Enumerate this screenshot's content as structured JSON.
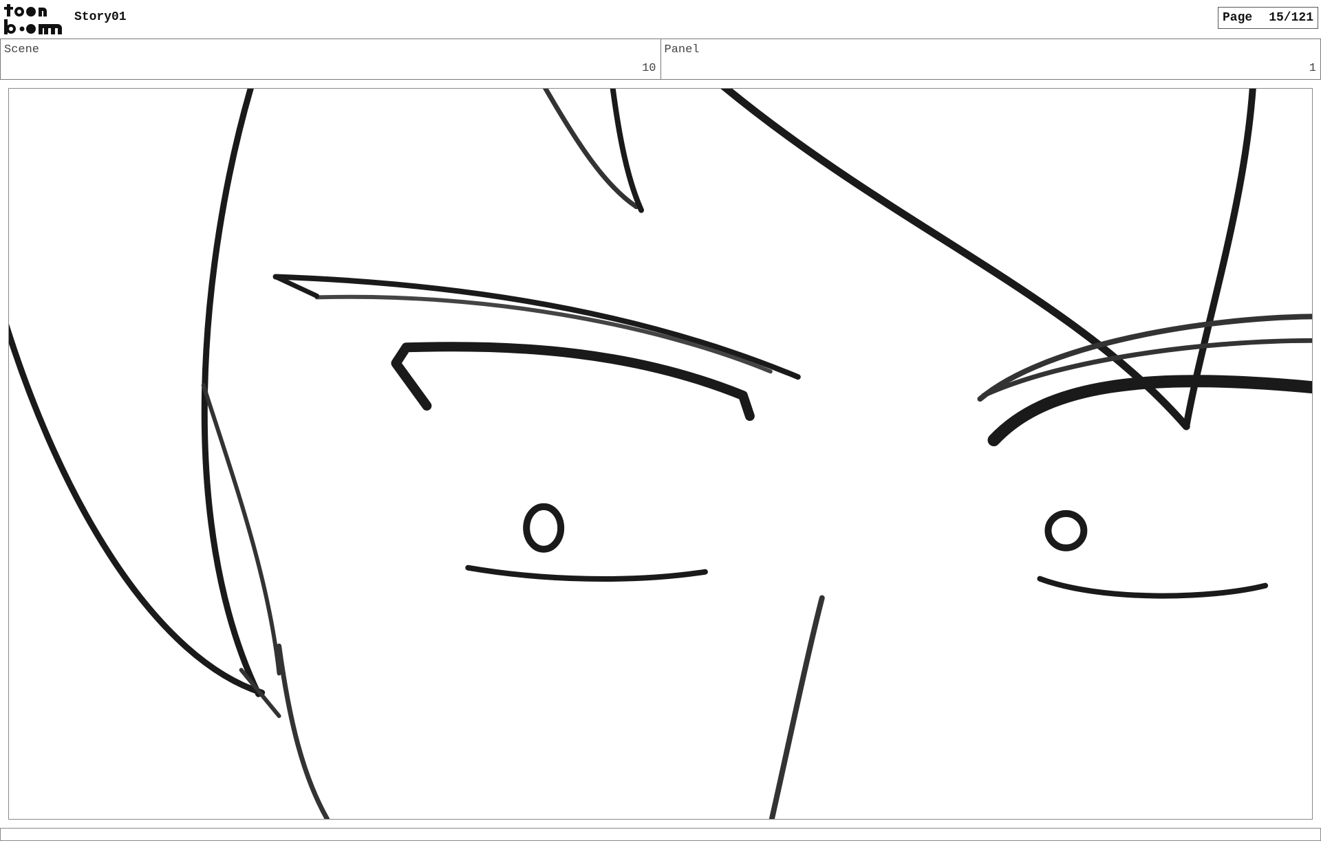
{
  "header": {
    "logo_text": "toon boom",
    "project_title": "Story01",
    "page_label": "Page",
    "page_value": "15/121"
  },
  "info": {
    "scene_label": "Scene",
    "scene_value": "10",
    "panel_label": "Panel",
    "panel_value": "1"
  },
  "panel_image": {
    "icon": "storyboard-sketch-image",
    "stroke_color": "#1a1a1a"
  },
  "caption": ""
}
